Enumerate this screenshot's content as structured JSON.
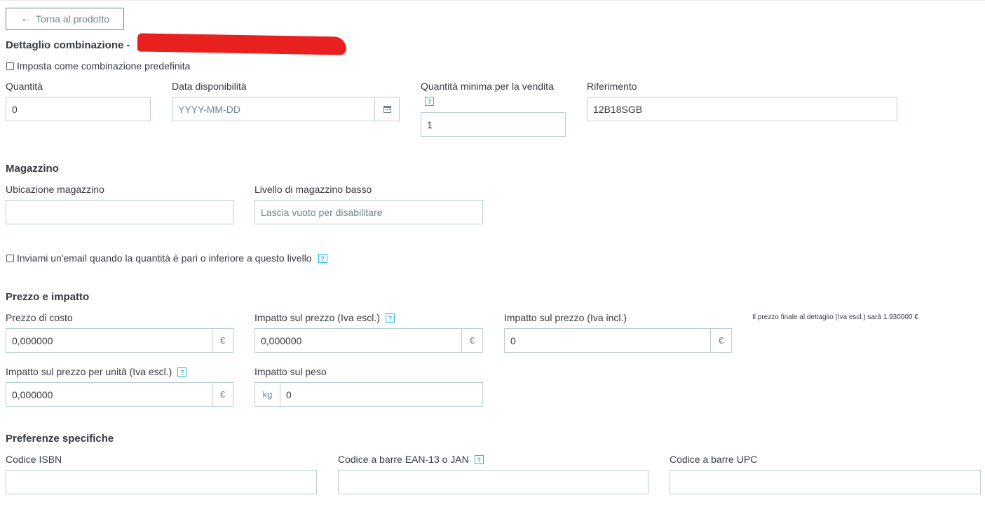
{
  "back_button": {
    "label": "Torna al prodotto"
  },
  "title": "Dettaglio combinazione -",
  "default_checkbox": {
    "label": "Imposta come combinazione predefinita"
  },
  "fields": {
    "quantity": {
      "label": "Quantità",
      "value": "0"
    },
    "availability_date": {
      "label": "Data disponibilità",
      "placeholder": "YYYY-MM-DD"
    },
    "min_quantity": {
      "label": "Quantità minima per la vendita",
      "value": "1"
    },
    "reference": {
      "label": "Riferimento",
      "value": "12B18SGB"
    }
  },
  "stock": {
    "heading": "Magazzino",
    "location": {
      "label": "Ubicazione magazzino",
      "value": ""
    },
    "low_level": {
      "label": "Livello di magazzino basso",
      "placeholder": "Lascia vuoto per disabilitare"
    },
    "email_checkbox": {
      "label": "Inviami un'email quando la quantità è pari o inferiore a questo livello"
    }
  },
  "price": {
    "heading": "Prezzo e impatto",
    "cost_price": {
      "label": "Prezzo di costo",
      "value": "0,000000",
      "unit": "€"
    },
    "impact_excl": {
      "label": "Impatto sul prezzo (Iva escl.)",
      "value": "0,000000",
      "unit": "€"
    },
    "impact_incl": {
      "label": "Impatto sul prezzo (Iva incl.)",
      "value": "0",
      "unit": "€"
    },
    "final_note": "Il prezzo finale al dettaglio (Iva escl.) sarà 1.930000 €",
    "unit_impact": {
      "label": "Impatto sul prezzo per unità (Iva escl.)",
      "value": "0,000000",
      "unit": "€"
    },
    "weight_impact": {
      "label": "Impatto sul peso",
      "value": "0",
      "unit": "kg"
    }
  },
  "specific": {
    "heading": "Preferenze specifiche",
    "isbn": {
      "label": "Codice ISBN",
      "value": ""
    },
    "ean13": {
      "label": "Codice a barre EAN-13 o JAN",
      "value": ""
    },
    "upc": {
      "label": "Codice a barre UPC",
      "value": ""
    }
  },
  "help_glyph": "?",
  "icons": {
    "back": "arrow-left-icon",
    "calendar": "calendar-icon",
    "help": "help-icon"
  },
  "colors": {
    "accent": "#25b9d7",
    "border": "#bbcdd2",
    "text": "#363a41",
    "muted": "#6c868e",
    "redaction": "#e8201f"
  }
}
